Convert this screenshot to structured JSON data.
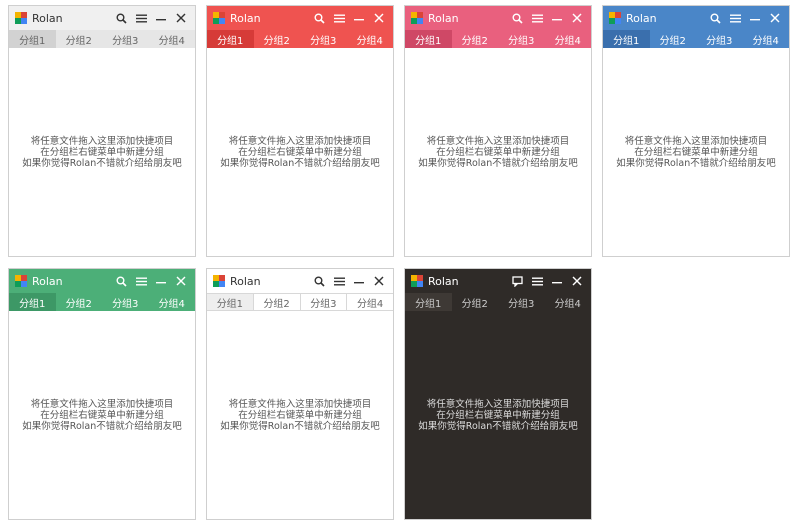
{
  "app_title": "Rolan",
  "tabs": [
    "分组1",
    "分组2",
    "分组3",
    "分组4"
  ],
  "message_lines": [
    "将任意文件拖入这里添加快捷项目",
    "在分组栏右键菜单中新建分组",
    "如果你觉得Rolan不错就介绍给朋友吧"
  ],
  "themes": [
    {
      "name": "gray",
      "title_bg": "#f0f0f0",
      "tab_bg": "#e6e6e6",
      "active_tab_bg": "#d2d2d2",
      "text": "#333333",
      "tab_text": "#666666",
      "content_bg": "#ffffff",
      "content_text": "#555555",
      "first_ctrl": "search-icon"
    },
    {
      "name": "red",
      "title_bg": "#ef5350",
      "tab_bg": "#ef5350",
      "active_tab_bg": "#d63b38",
      "text": "#ffffff",
      "tab_text": "#ffffff",
      "content_bg": "#ffffff",
      "content_text": "#555555",
      "first_ctrl": "search-icon"
    },
    {
      "name": "pink",
      "title_bg": "#e9607e",
      "tab_bg": "#e9607e",
      "active_tab_bg": "#cf4866",
      "text": "#ffffff",
      "tab_text": "#ffffff",
      "content_bg": "#ffffff",
      "content_text": "#555555",
      "first_ctrl": "search-icon"
    },
    {
      "name": "blue",
      "title_bg": "#4a86c8",
      "tab_bg": "#4a86c8",
      "active_tab_bg": "#3a6fad",
      "text": "#ffffff",
      "tab_text": "#ffffff",
      "content_bg": "#ffffff",
      "content_text": "#555555",
      "first_ctrl": "search-icon"
    },
    {
      "name": "green",
      "title_bg": "#4caf78",
      "tab_bg": "#4caf78",
      "active_tab_bg": "#3d9866",
      "text": "#ffffff",
      "tab_text": "#ffffff",
      "content_bg": "#ffffff",
      "content_text": "#555555",
      "first_ctrl": "search-icon"
    },
    {
      "name": "white",
      "title_bg": "#ffffff",
      "tab_bg": "#ffffff",
      "active_tab_bg": "#eeeeee",
      "text": "#333333",
      "tab_text": "#666666",
      "content_bg": "#ffffff",
      "content_text": "#555555",
      "first_ctrl": "search-icon",
      "tab_borders": true
    },
    {
      "name": "dark",
      "title_bg": "#2f2b28",
      "tab_bg": "#2f2b28",
      "active_tab_bg": "#3e3935",
      "text": "#ffffff",
      "tab_text": "#cccccc",
      "content_bg": "#2f2b28",
      "content_text": "#dddddd",
      "first_ctrl": "comment-icon"
    }
  ]
}
